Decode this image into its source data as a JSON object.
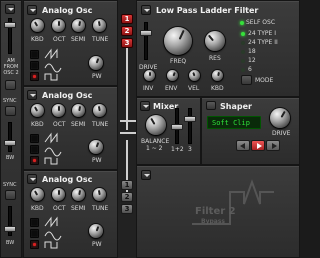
{
  "osc": [
    {
      "title": "Analog Osc",
      "knobs": [
        "KBD",
        "OCT",
        "SEMI",
        "TUNE"
      ],
      "pw_label": "PW"
    },
    {
      "title": "Analog Osc",
      "knobs": [
        "KBD",
        "OCT",
        "SEMI",
        "TUNE"
      ],
      "pw_label": "PW"
    },
    {
      "title": "Analog Osc",
      "knobs": [
        "KBD",
        "OCT",
        "SEMI",
        "TUNE"
      ],
      "pw_label": "PW"
    }
  ],
  "left_strip": {
    "am_label": "AM FROM OSC 2",
    "sync_label_1": "SYNC",
    "bw_label_1": "BW",
    "sync_label_2": "SYNC",
    "bw_label_2": "BW"
  },
  "filter": {
    "title": "Low Pass Ladder Filter",
    "tabs": [
      "1",
      "2",
      "3"
    ],
    "drive_label": "DRIVE",
    "freq_label": "FREQ",
    "res_label": "RES",
    "small_knobs": [
      "INV",
      "ENV",
      "VEL",
      "KBD"
    ],
    "self_osc_label": "SELF OSC",
    "types": [
      "24 TYPE I",
      "24 TYPE II",
      "18",
      "12",
      "6"
    ],
    "mode_label": "MODE"
  },
  "mixer": {
    "title": "Mixer",
    "balance_label": "BALANCE",
    "balance_sub": "1 ~ 2",
    "fader_labels": [
      "1+2",
      "3"
    ]
  },
  "shaper": {
    "title": "Shaper",
    "display_value": "Soft Clip",
    "drive_label": "DRIVE"
  },
  "filter2": {
    "title": "Filter 2",
    "subtitle": "Bypass",
    "tabs": [
      "1",
      "2",
      "3"
    ]
  },
  "colors": {
    "accent_red": "#d83838",
    "led_green": "#36e03b",
    "display_bg": "#0a2a0a",
    "display_text": "#2fe03a"
  }
}
